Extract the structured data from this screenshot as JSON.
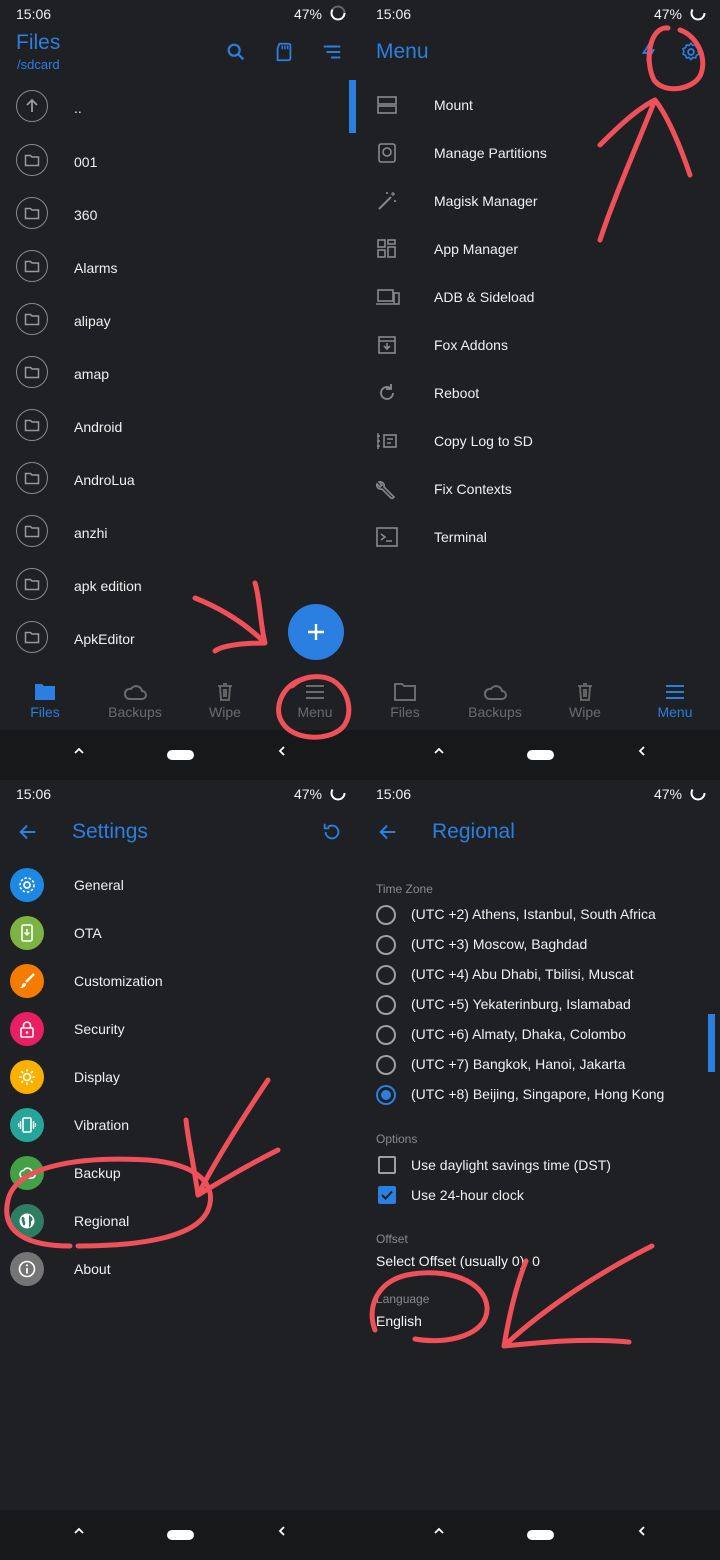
{
  "status": {
    "time": "15:06",
    "battery": "47%"
  },
  "files": {
    "title": "Files",
    "path": "/sdcard",
    "items": [
      "..",
      "001",
      "360",
      "Alarms",
      "alipay",
      "amap",
      "Android",
      "AndroLua",
      "anzhi",
      "apk edition",
      "ApkEditor"
    ]
  },
  "bottom_nav": {
    "files": "Files",
    "backups": "Backups",
    "wipe": "Wipe",
    "menu": "Menu"
  },
  "menu": {
    "title": "Menu",
    "items": [
      "Mount",
      "Manage Partitions",
      "Magisk Manager",
      "App Manager",
      "ADB & Sideload",
      "Fox Addons",
      "Reboot",
      "Copy Log to SD",
      "Fix Contexts",
      "Terminal"
    ]
  },
  "settings": {
    "title": "Settings",
    "items": [
      "General",
      "OTA",
      "Customization",
      "Security",
      "Display",
      "Vibration",
      "Backup",
      "Regional",
      "About"
    ]
  },
  "regional": {
    "title": "Regional",
    "timezone_label": "Time Zone",
    "timezones": [
      "(UTC +2) Athens, Istanbul, South Africa",
      "(UTC +3) Moscow, Baghdad",
      "(UTC +4) Abu Dhabi, Tbilisi, Muscat",
      "(UTC +5) Yekaterinburg, Islamabad",
      "(UTC +6) Almaty, Dhaka, Colombo",
      "(UTC +7) Bangkok, Hanoi, Jakarta",
      "(UTC +8) Beijing, Singapore, Hong Kong"
    ],
    "selected_timezone": "(UTC +8) Beijing, Singapore, Hong Kong",
    "options_label": "Options",
    "options": [
      {
        "label": "Use daylight savings time (DST)",
        "checked": false
      },
      {
        "label": "Use 24-hour clock",
        "checked": true
      }
    ],
    "offset_label": "Offset",
    "offset_value": "Select Offset (usually 0): 0",
    "language_label": "Language",
    "language_value": "English"
  },
  "colors": {
    "accent": "#2b7fe0",
    "background": "#1f2023",
    "annotation": "#f0505a"
  }
}
